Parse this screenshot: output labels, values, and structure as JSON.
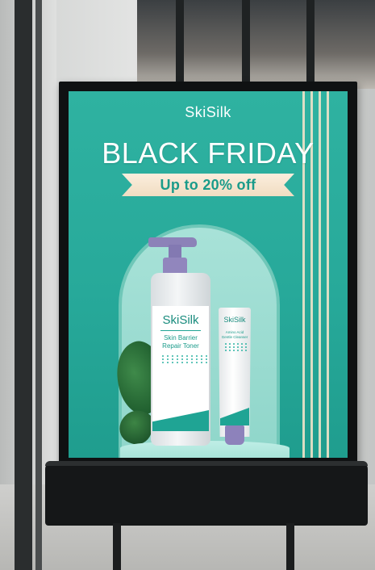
{
  "poster": {
    "brand": "SkiSilk",
    "headline": "BLACK FRIDAY",
    "offer": "Up to 20% off"
  },
  "products": {
    "bottle": {
      "brand": "SkiSilk",
      "name_line1": "Skin Barrier",
      "name_line2": "Repair Toner"
    },
    "tube": {
      "brand": "SkiSilk",
      "name_line1": "Amino Acid",
      "name_line2": "Gentle Cleanser"
    }
  },
  "colors": {
    "poster_teal": "#27a99a",
    "ribbon_cream": "#f1ddc2",
    "offer_text": "#1a9b8a",
    "cap_purple": "#8c82b8",
    "frame_black": "#0f1112"
  }
}
